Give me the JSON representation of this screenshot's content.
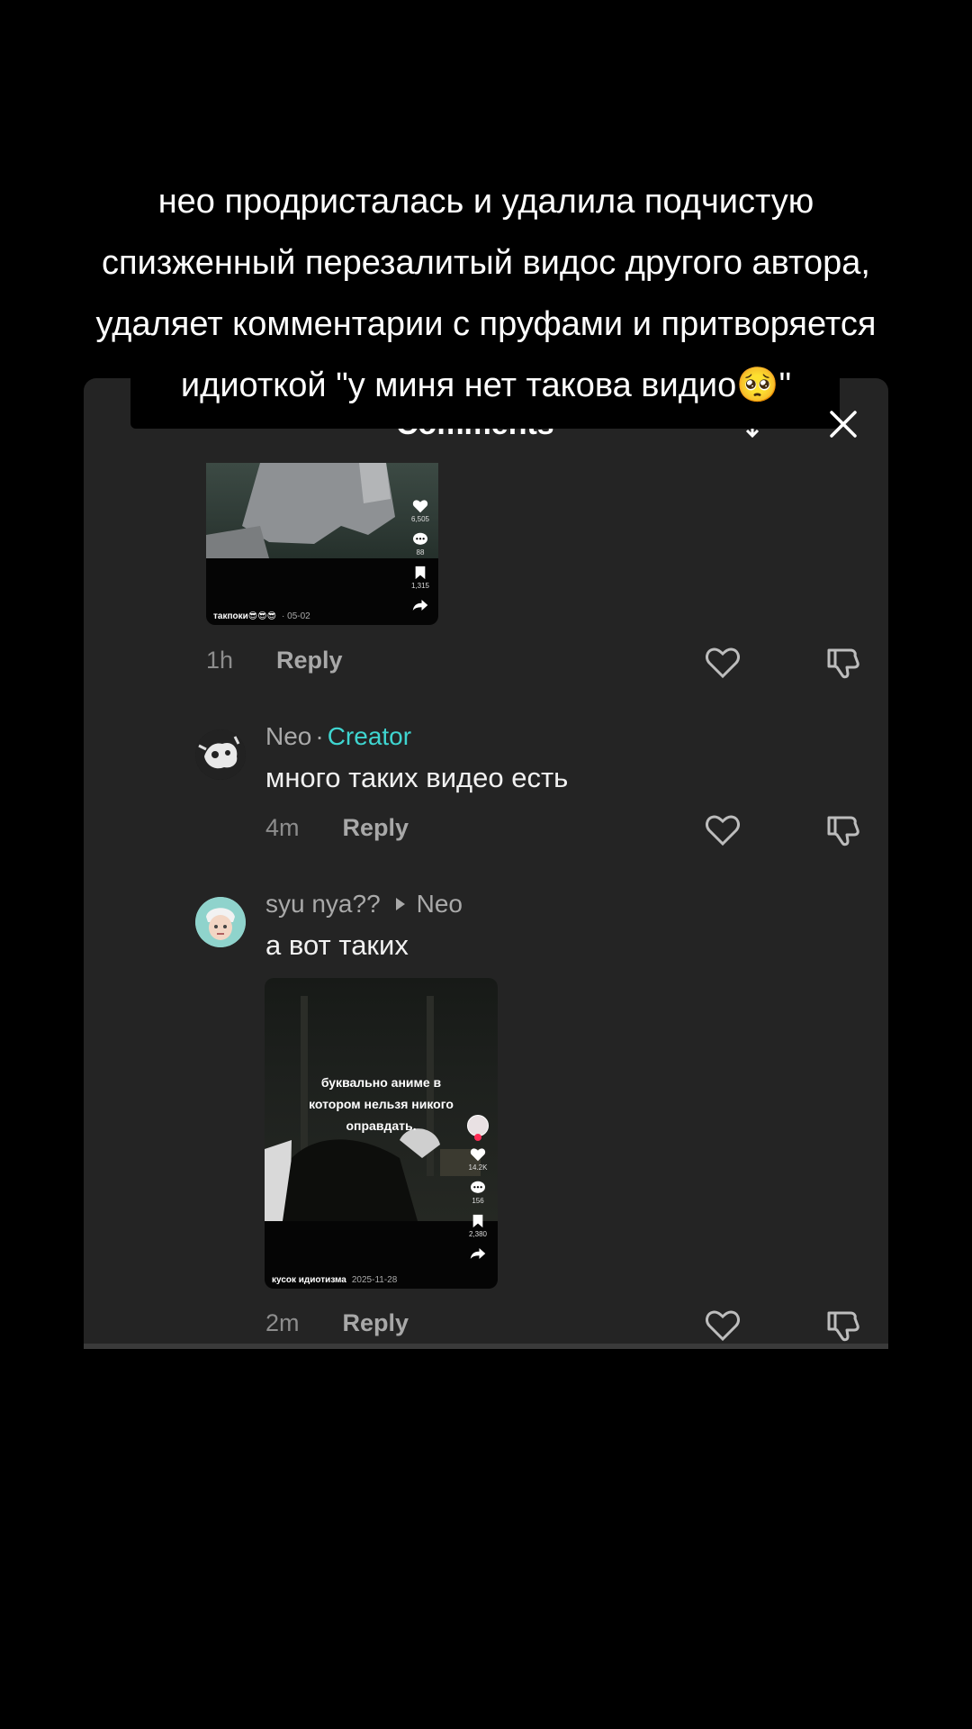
{
  "caption": {
    "lines": [
      "нео продристалась и удалила подчистую",
      "спизженный перезалитый видос другого автора,",
      "удаляет комментарии с пруфами и притворяется",
      "идиоткой \"у миня нет такова видио🥺\""
    ]
  },
  "panel": {
    "title": "Comments"
  },
  "comments": [
    {
      "thumbnail": {
        "caption": "такпоки😎😎😎",
        "date": "· 05-02",
        "counts": [
          "6,505",
          "88",
          "1,315",
          ""
        ]
      },
      "time": "1h",
      "reply_label": "Reply"
    },
    {
      "username": "Neo",
      "badge": "Creator",
      "text": "много таких видео есть",
      "time": "4m",
      "reply_label": "Reply"
    },
    {
      "username": "syu nya??",
      "reply_to": "Neo",
      "text": "а вот таких",
      "thumbnail": {
        "overlay_text": [
          "буквально аниме в",
          "котором нельзя никого",
          "оправдать."
        ],
        "caption": "кусок идиотизма",
        "date": "2025-11-28",
        "counts": [
          "14.2K",
          "156",
          "2,380",
          ""
        ]
      },
      "time": "2m",
      "reply_label": "Reply"
    }
  ],
  "colors": {
    "creator_badge": "#3fd5d0",
    "panel_bg": "#242424",
    "page_bg": "#000000"
  }
}
